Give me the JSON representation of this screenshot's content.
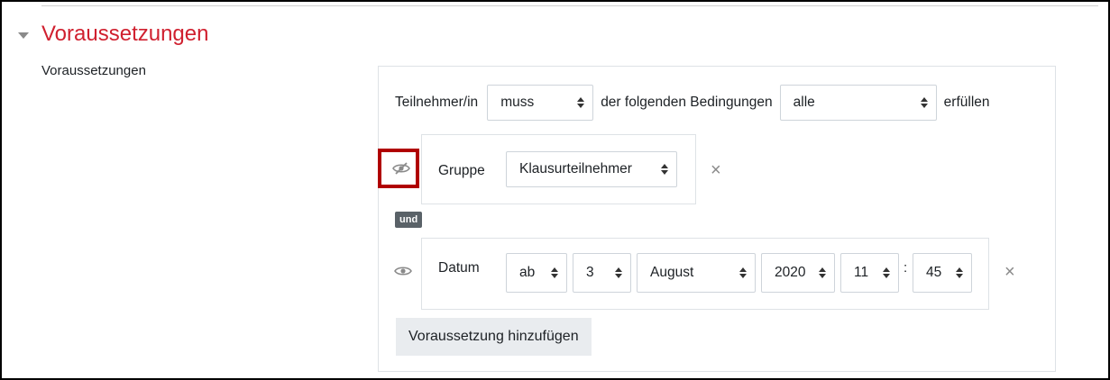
{
  "section": {
    "title": "Voraussetzungen"
  },
  "field": {
    "label": "Voraussetzungen"
  },
  "header_row": {
    "prefix": "Teilnehmer/in",
    "must_select": "muss",
    "middle": "der folgenden Bedingungen",
    "all_select": "alle",
    "suffix": "erfüllen"
  },
  "condition_group": {
    "label": "Gruppe",
    "value": "Klausurteilnehmer",
    "eye_icon": "eye-slash-icon"
  },
  "connector": {
    "label": "und"
  },
  "condition_date": {
    "label": "Datum",
    "direction": "ab",
    "day": "3",
    "month": "August",
    "year": "2020",
    "hour": "11",
    "minute": "45",
    "separator": ":",
    "eye_icon": "eye-icon"
  },
  "close_symbol": "×",
  "add_button": {
    "label": "Voraussetzung hinzufügen"
  },
  "colors": {
    "accent": "#d0202f",
    "highlight": "#b00000",
    "badge": "#5a6268"
  }
}
